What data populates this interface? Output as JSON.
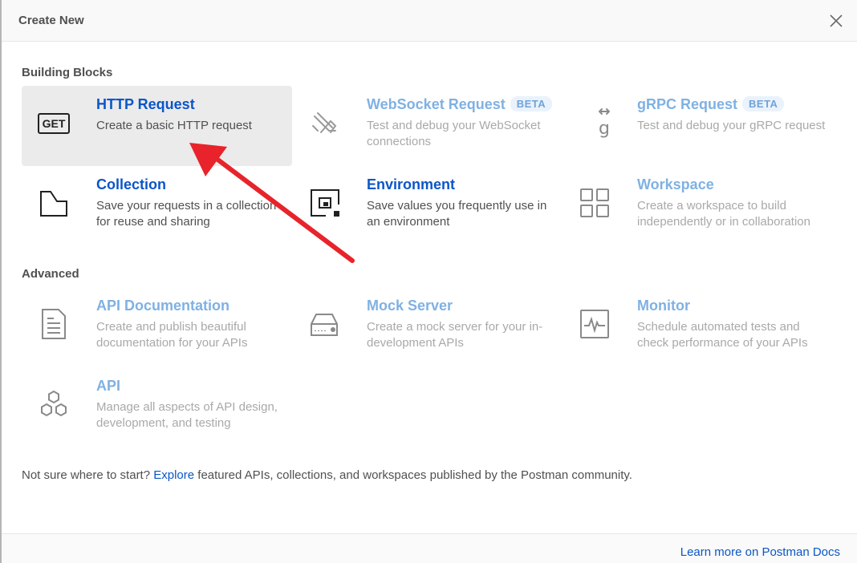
{
  "dialog": {
    "title": "Create New"
  },
  "sections": {
    "building_blocks": "Building Blocks",
    "advanced": "Advanced"
  },
  "tiles": [
    {
      "title": "HTTP Request",
      "desc": "Create a basic HTTP request",
      "icon": "get-icon",
      "state": "selected"
    },
    {
      "title": "WebSocket Request",
      "badge": "BETA",
      "desc": "Test and debug your WebSocket connections",
      "icon": "websocket-icon",
      "state": "disabled"
    },
    {
      "title": "gRPC Request",
      "badge": "BETA",
      "desc": "Test and debug your gRPC request",
      "icon": "grpc-icon",
      "state": "disabled"
    },
    {
      "title": "Collection",
      "desc": "Save your requests in a collection for reuse and sharing",
      "icon": "collection-icon",
      "state": "enabled"
    },
    {
      "title": "Environment",
      "desc": "Save values you frequently use in an environment",
      "icon": "environment-icon",
      "state": "enabled"
    },
    {
      "title": "Workspace",
      "desc": "Create a workspace to build independently or in collaboration",
      "icon": "workspace-icon",
      "state": "disabled"
    },
    {
      "title": "API Documentation",
      "desc": "Create and publish beautiful documentation for your APIs",
      "icon": "document-icon",
      "state": "disabled"
    },
    {
      "title": "Mock Server",
      "desc": "Create a mock server for your in-development APIs",
      "icon": "server-icon",
      "state": "disabled"
    },
    {
      "title": "Monitor",
      "desc": "Schedule automated tests and check performance of your APIs",
      "icon": "monitor-icon",
      "state": "disabled"
    },
    {
      "title": "API",
      "desc": "Manage all aspects of API design, development, and testing",
      "icon": "api-hexagons-icon",
      "state": "disabled"
    }
  ],
  "footer": {
    "prefix": "Not sure where to start? ",
    "link": "Explore",
    "suffix": " featured APIs, collections, and workspaces published by the Postman community.",
    "docs_link": "Learn more on Postman Docs"
  },
  "colors": {
    "accent": "#0b56c8",
    "disabled_accent": "#7fb1e3",
    "annotation_arrow": "#e8232b"
  }
}
